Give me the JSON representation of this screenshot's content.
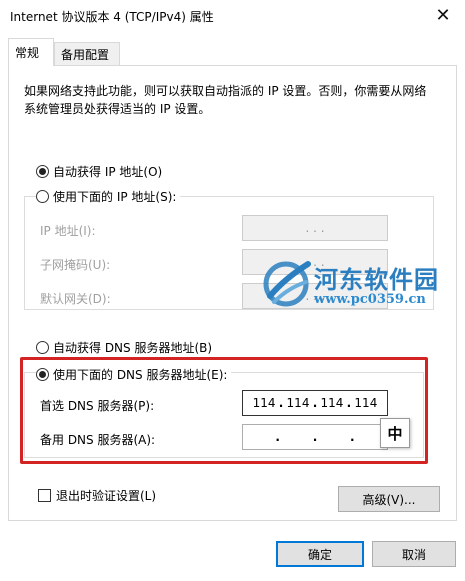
{
  "window": {
    "title": "Internet 协议版本 4 (TCP/IPv4) 属性",
    "close_glyph": "✕"
  },
  "tabs": [
    {
      "label": "常规",
      "active": true
    },
    {
      "label": "备用配置",
      "active": false
    }
  ],
  "description": "如果网络支持此功能，则可以获取自动指派的 IP 设置。否则，你需要从网络系统管理员处获得适当的 IP 设置。",
  "ip_section": {
    "auto_label": "自动获得 IP 地址(O)",
    "auto_selected": true,
    "manual_label": "使用下面的 IP 地址(S):",
    "fields": [
      {
        "label": "IP 地址(I):",
        "value": ".   .   ."
      },
      {
        "label": "子网掩码(U):",
        "value": ".   .   ."
      },
      {
        "label": "默认网关(D):",
        "value": ".   .   ."
      }
    ]
  },
  "dns_section": {
    "auto_label": "自动获得 DNS 服务器地址(B)",
    "manual_label": "使用下面的 DNS 服务器地址(E):",
    "manual_selected": true,
    "preferred_label": "首选 DNS 服务器(P):",
    "preferred_value": [
      "114",
      "114",
      "114",
      "114"
    ],
    "alternate_label": "备用 DNS 服务器(A):",
    "alternate_value": [
      ".",
      ".",
      "."
    ]
  },
  "ime_indicator": "中",
  "validate_label": "退出时验证设置(L)",
  "advanced_button": "高级(V)...",
  "ok_button": "确定",
  "cancel_button": "取消",
  "watermark": {
    "name": "河东软件园",
    "url": "www.pc0359.cn"
  },
  "colors": {
    "highlight": "#d32323",
    "accent": "#0078d7",
    "watermark": "#2b7fc0"
  }
}
